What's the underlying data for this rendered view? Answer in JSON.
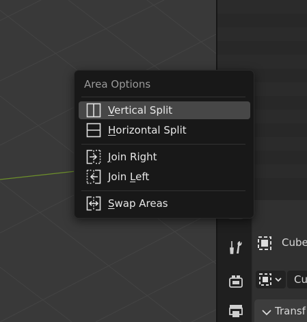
{
  "menu": {
    "title": "Area Options",
    "items": [
      {
        "pre": "",
        "ul": "V",
        "post": "ertical Split",
        "icon": "vertical-split-icon"
      },
      {
        "pre": "",
        "ul": "H",
        "post": "orizontal Split",
        "icon": "horizontal-split-icon"
      },
      {
        "pre": "",
        "ul": "J",
        "post": "oin Right",
        "icon": "join-right-icon"
      },
      {
        "pre": "Join ",
        "ul": "L",
        "post": "eft",
        "icon": "join-left-icon"
      },
      {
        "pre": "",
        "ul": "S",
        "post": "wap Areas",
        "icon": "swap-areas-icon"
      }
    ]
  },
  "properties": {
    "object_name": "Cube",
    "data_field": "Cu",
    "panel": "Transf"
  },
  "colors": {
    "menu_bg": "#181818",
    "highlight": "#474747",
    "x_axis": "#6d8f2b"
  }
}
